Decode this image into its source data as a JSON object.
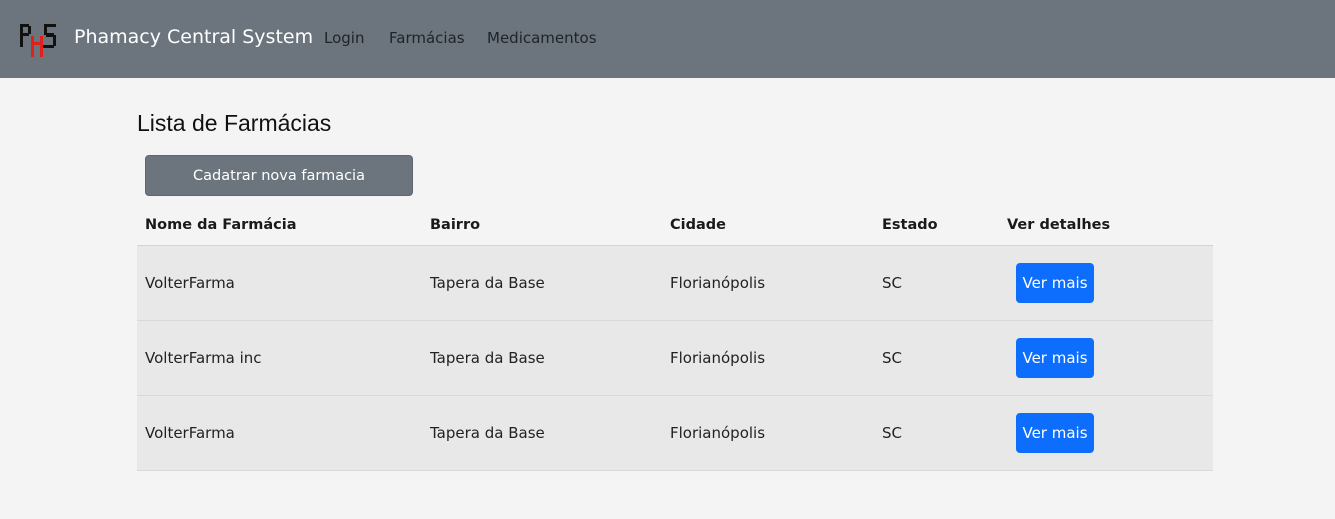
{
  "navbar": {
    "brand": "Phamacy Central System",
    "links": [
      "Login",
      "Farmácias",
      "Medicamentos"
    ],
    "logo_icon": "phs-logo-icon",
    "background": "#6c757d"
  },
  "main": {
    "title": "Lista de Farmácias",
    "new_button_label": "Cadatrar nova farmacia",
    "table": {
      "headers": [
        "Nome da Farmácia",
        "Bairro",
        "Cidade",
        "Estado",
        "Ver detalhes"
      ],
      "rows": [
        {
          "nome": "VolterFarma",
          "bairro": "Tapera da Base",
          "cidade": "Florianópolis",
          "estado": "SC",
          "action": "Ver mais"
        },
        {
          "nome": "VolterFarma inc",
          "bairro": "Tapera da Base",
          "cidade": "Florianópolis",
          "estado": "SC",
          "action": "Ver mais"
        },
        {
          "nome": "VolterFarma",
          "bairro": "Tapera da Base",
          "cidade": "Florianópolis",
          "estado": "SC",
          "action": "Ver mais"
        }
      ]
    }
  },
  "colors": {
    "accent": "#0d6efd",
    "secondary": "#6c757d",
    "row_background": "#e8e8e8",
    "page_background": "#f4f4f4"
  }
}
